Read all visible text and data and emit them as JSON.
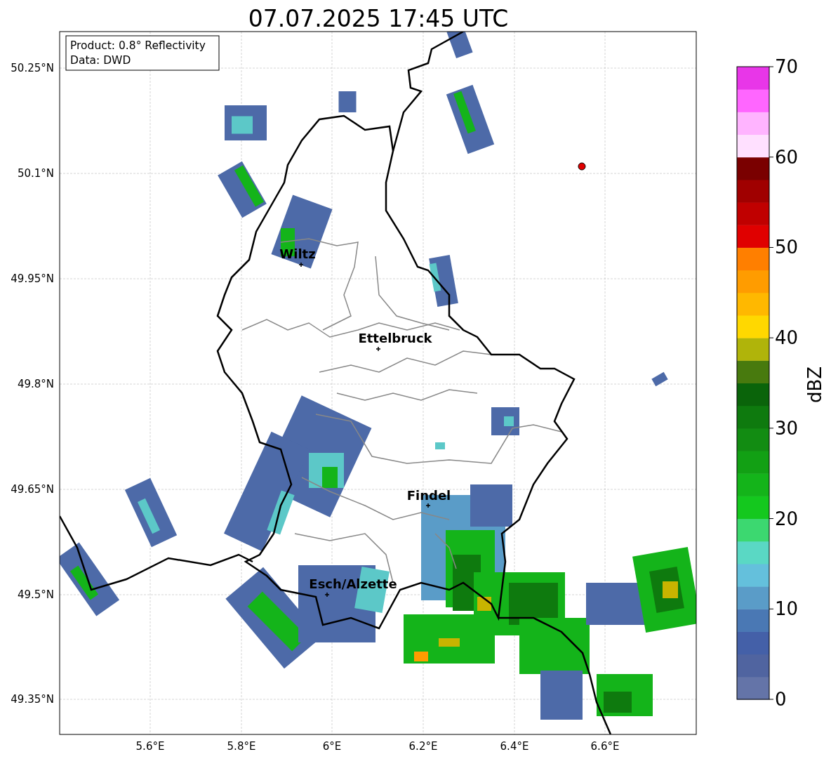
{
  "title": "07.07.2025 17:45 UTC",
  "info_box": [
    "Product: 0.8° Reflectivity",
    "Data: DWD"
  ],
  "y_ticks": [
    "50.25°N",
    "50.1°N",
    "49.95°N",
    "49.8°N",
    "49.65°N",
    "49.5°N",
    "49.35°N"
  ],
  "x_ticks": [
    "5.6°E",
    "5.8°E",
    "6°E",
    "6.2°E",
    "6.4°E",
    "6.6°E"
  ],
  "cities": [
    {
      "name": "Wiltz"
    },
    {
      "name": "Ettelbruck"
    },
    {
      "name": "Findel"
    },
    {
      "name": "Esch/Alzette"
    }
  ],
  "colorbar": {
    "label": "dBZ",
    "ticks": [
      "70",
      "60",
      "50",
      "40",
      "30",
      "20",
      "10",
      "0"
    ],
    "segments": [
      {
        "color": "#6474a8"
      },
      {
        "color": "#5064a0"
      },
      {
        "color": "#4460a8"
      },
      {
        "color": "#4a78b4"
      },
      {
        "color": "#5a9cc8"
      },
      {
        "color": "#64c0dc"
      },
      {
        "color": "#5ad8c4"
      },
      {
        "color": "#3cd870"
      },
      {
        "color": "#14c81e"
      },
      {
        "color": "#14b41a"
      },
      {
        "color": "#12a014"
      },
      {
        "color": "#128c12"
      },
      {
        "color": "#0e7a0e"
      },
      {
        "color": "#0a640a"
      },
      {
        "color": "#487a0e"
      },
      {
        "color": "#b0b40a"
      },
      {
        "color": "#ffd800"
      },
      {
        "color": "#ffb800"
      },
      {
        "color": "#ff9c00"
      },
      {
        "color": "#ff7f00"
      },
      {
        "color": "#e00000"
      },
      {
        "color": "#c00000"
      },
      {
        "color": "#a00000"
      },
      {
        "color": "#7a0000"
      },
      {
        "color": "#ffe0ff"
      },
      {
        "color": "#ffb4ff"
      },
      {
        "color": "#ff66ff"
      },
      {
        "color": "#e836e8"
      }
    ]
  }
}
